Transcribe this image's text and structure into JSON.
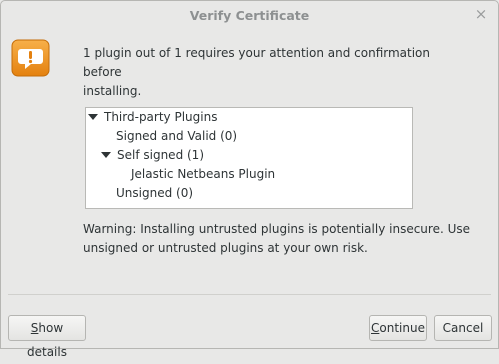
{
  "dialog": {
    "title": "Verify Certificate",
    "close_glyph": "×",
    "icon": "warning-icon",
    "message_line1": "1 plugin out of 1 requires your attention and confirmation before",
    "message_line2": "installing.",
    "warning_line1": "Warning: Installing untrusted plugins is potentially insecure. Use",
    "warning_line2": "unsigned or untrusted plugins at your own risk."
  },
  "tree": {
    "items": [
      {
        "label": "Third-party Plugins",
        "expanded": true
      },
      {
        "label": "Signed and Valid (0)"
      },
      {
        "label": "Self signed (1)",
        "expanded": true
      },
      {
        "label": "Jelastic Netbeans Plugin"
      },
      {
        "label": "Unsigned (0)"
      }
    ]
  },
  "buttons": {
    "show_details_first": "S",
    "show_details_rest": "how details",
    "continue_first": "C",
    "continue_rest": "ontinue",
    "cancel": "Cancel"
  },
  "colors": {
    "background": "#e8e8e7",
    "icon_orange": "#f0961e"
  }
}
